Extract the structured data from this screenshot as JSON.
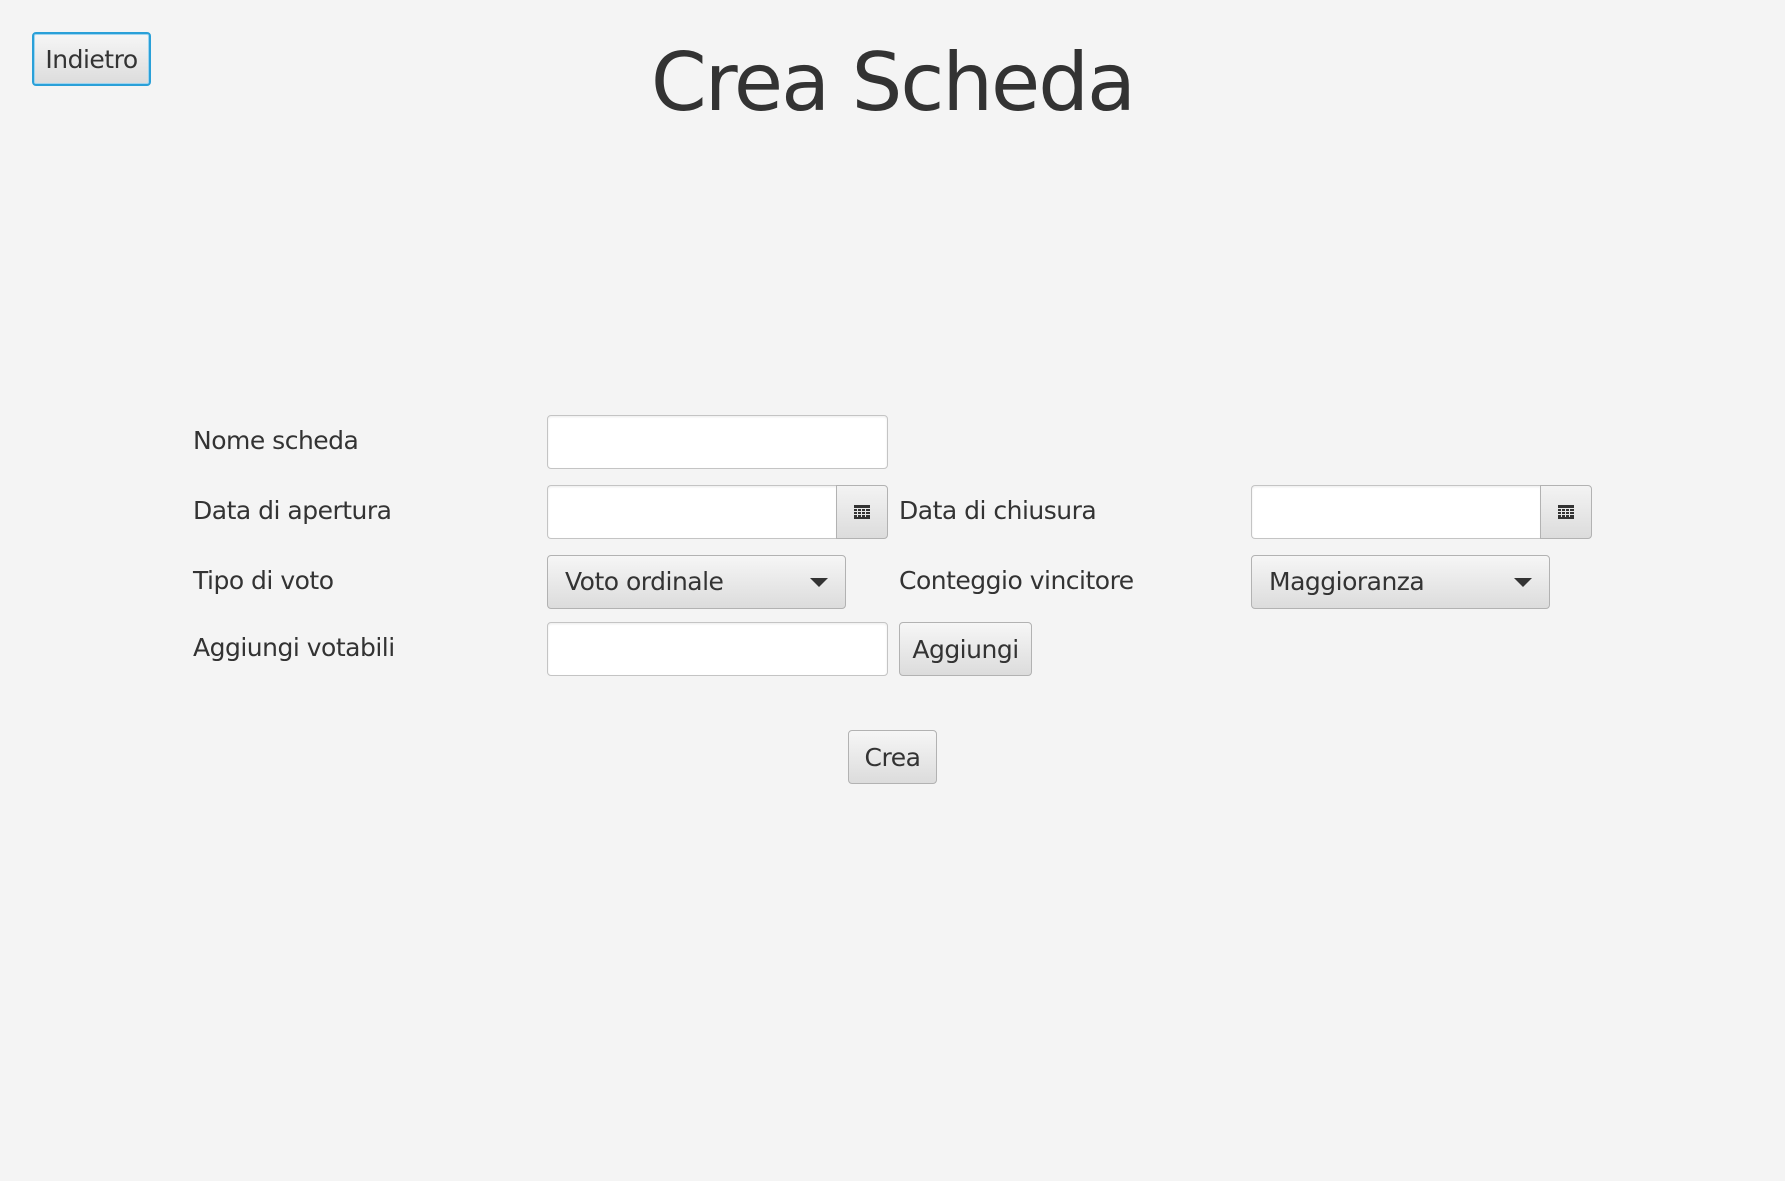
{
  "header": {
    "back_label": "Indietro",
    "title": "Crea Scheda"
  },
  "form": {
    "nome_scheda": {
      "label": "Nome scheda",
      "value": ""
    },
    "data_apertura": {
      "label": "Data di apertura",
      "value": "",
      "icon": "calendar-icon"
    },
    "data_chiusura": {
      "label": "Data di chiusura",
      "value": "",
      "icon": "calendar-icon"
    },
    "tipo_voto": {
      "label": "Tipo di voto",
      "selected": "Voto ordinale"
    },
    "conteggio_vincitore": {
      "label": "Conteggio vincitore",
      "selected": "Maggioranza"
    },
    "aggiungi_votabili": {
      "label": "Aggiungi votabili",
      "value": "",
      "add_label": "Aggiungi"
    },
    "submit_label": "Crea"
  },
  "colors": {
    "background": "#f4f4f4",
    "focus_border": "#2aa0d8",
    "text": "#333333"
  }
}
